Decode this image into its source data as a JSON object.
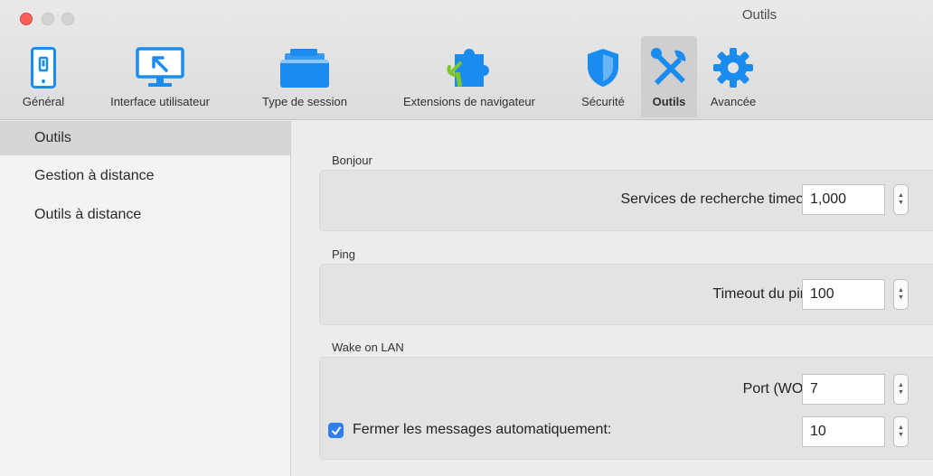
{
  "window": {
    "title": "Outils"
  },
  "toolbar": {
    "items": [
      {
        "label": "Général",
        "icon": "switch-icon"
      },
      {
        "label": "Interface utilisateur",
        "icon": "monitor-icon"
      },
      {
        "label": "Type de session",
        "icon": "folder-stack-icon"
      },
      {
        "label": "Extensions de navigateur",
        "icon": "puzzle-icon"
      },
      {
        "label": "Sécurité",
        "icon": "shield-icon"
      },
      {
        "label": "Outils",
        "icon": "tools-icon",
        "selected": true
      },
      {
        "label": "Avancée",
        "icon": "gear-icon"
      }
    ]
  },
  "sidebar": {
    "items": [
      {
        "label": "Outils",
        "active": true
      },
      {
        "label": "Gestion à distance"
      },
      {
        "label": "Outils à distance"
      }
    ]
  },
  "bonjour": {
    "title": "Bonjour",
    "search_label": "Services de recherche timeout:",
    "search_value": "1,000"
  },
  "ping": {
    "title": "Ping",
    "timeout_label": "Timeout du ping:",
    "timeout_value": "100"
  },
  "wol": {
    "title": "Wake on LAN",
    "port_label": "Port (WOL):",
    "port_value": "7",
    "close_label": "Fermer les messages automatiquement:",
    "close_checked": true,
    "close_value": "10"
  },
  "colors": {
    "accent": "#2f7ff0",
    "close_button": "#fc5f57",
    "icon_blue": "#1a8cf0",
    "icon_green": "#7cc631"
  }
}
